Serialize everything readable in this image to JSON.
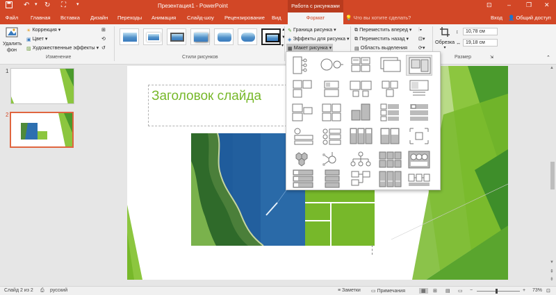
{
  "app": {
    "title": "Презентация1 - PowerPoint",
    "context_header": "Работа с рисунками"
  },
  "tabs": [
    "Файл",
    "Главная",
    "Вставка",
    "Дизайн",
    "Переходы",
    "Анимация",
    "Слайд-шоу",
    "Рецензирование",
    "Вид",
    "Формат"
  ],
  "active_tab": "Формат",
  "tell_me": "Что вы хотите сделать?",
  "sign_in": "Вход",
  "share": "Общий доступ",
  "ribbon": {
    "remove_bg_line1": "Удалить",
    "remove_bg_line2": "фон",
    "correction": "Коррекция",
    "color": "Цвет",
    "artistic": "Художественные эффекты",
    "group_adjust": "Изменение",
    "group_styles": "Стили рисунков",
    "border": "Граница рисунка",
    "effects": "Эффекты для рисунка",
    "layout": "Макет рисунка",
    "bring_forward": "Переместить вперед",
    "send_backward": "Переместить назад",
    "selection_pane": "Область выделения",
    "crop": "Обрезка",
    "height": "10,78 см",
    "width": "19,18 см",
    "group_size": "Размер"
  },
  "slides": [
    {
      "number": "1"
    },
    {
      "number": "2"
    }
  ],
  "slide": {
    "title": "Заголовок слайда"
  },
  "status": {
    "slide_info": "Слайд 2 из 2",
    "language": "русский",
    "notes": "Заметки",
    "comments": "Примечания",
    "zoom": "73%"
  },
  "colors": {
    "accent": "#d24726",
    "green": "#77b82a",
    "dark_green": "#4a9a2c"
  }
}
